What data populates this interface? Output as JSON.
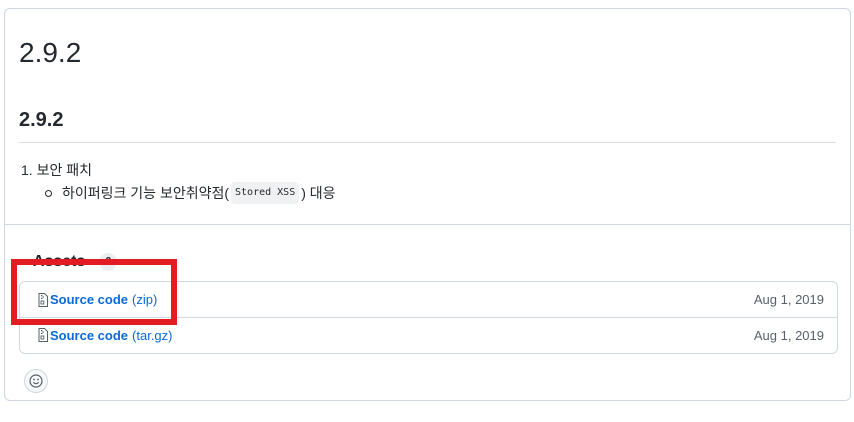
{
  "release": {
    "title": "2.9.2",
    "body_heading": "2.9.2",
    "list_item_1": "1. 보안 패치",
    "list_item_2_before": "하이퍼링크 기능 보안취약점(",
    "list_item_2_code": "Stored XSS",
    "list_item_2_after": ") 대응"
  },
  "assets": {
    "label": "Assets",
    "count": "2",
    "items": [
      {
        "name": "Source code",
        "ext": "(zip)",
        "date": "Aug 1, 2019"
      },
      {
        "name": "Source code",
        "ext": "(tar.gz)",
        "date": "Aug 1, 2019"
      }
    ]
  },
  "icons": {
    "asset_icon": "file-zip-icon",
    "reaction_icon": "smiley-icon",
    "disclosure_icon": "triangle-down-icon"
  },
  "colors": {
    "link": "#0969da",
    "highlight": "#e31b23",
    "border": "#d0d7de"
  }
}
